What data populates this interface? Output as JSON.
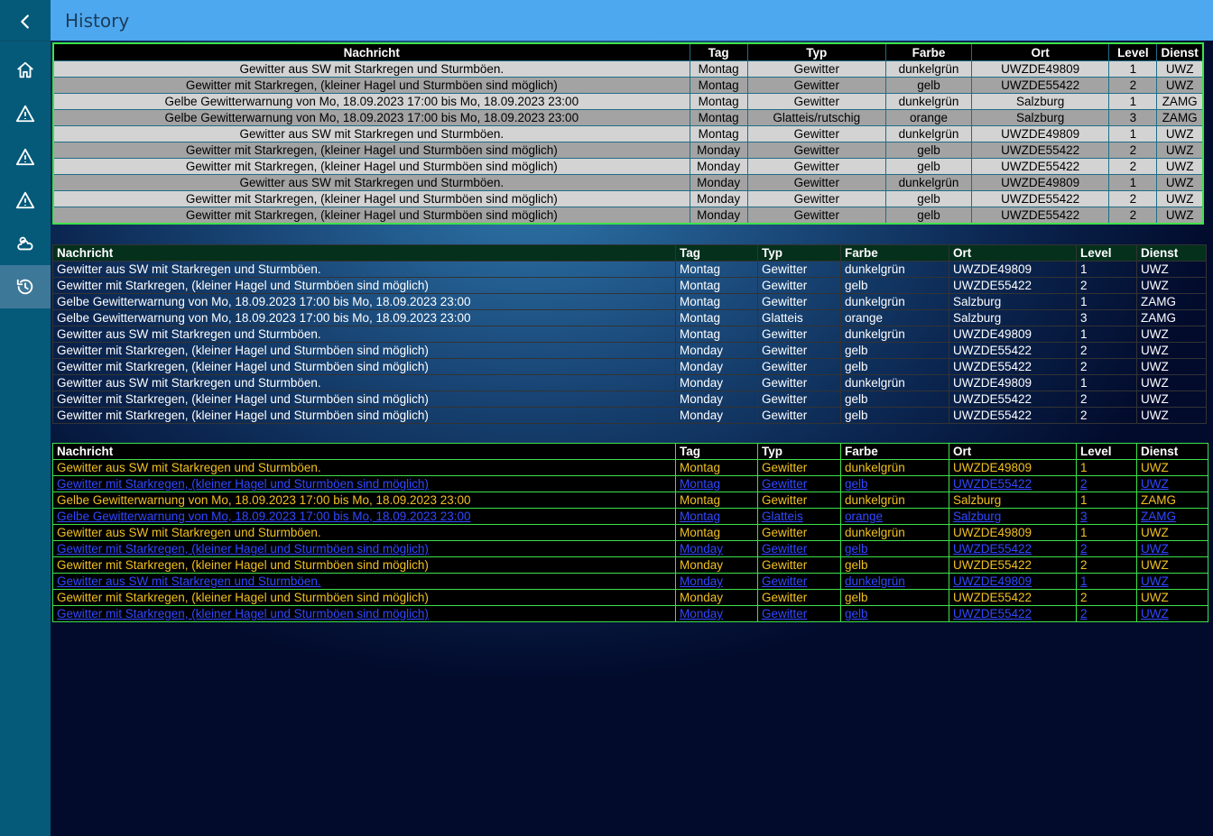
{
  "header": {
    "title": "History"
  },
  "sidebar": {
    "items": [
      {
        "id": "back",
        "icon": "back-chevron-icon"
      },
      {
        "id": "home",
        "icon": "home-icon"
      },
      {
        "id": "warn1",
        "icon": "warning-icon"
      },
      {
        "id": "warn2",
        "icon": "warning-icon"
      },
      {
        "id": "warn3",
        "icon": "warning-icon"
      },
      {
        "id": "weather",
        "icon": "weather-icon"
      },
      {
        "id": "history",
        "icon": "history-icon",
        "active": true
      }
    ]
  },
  "columns": [
    "Nachricht",
    "Tag",
    "Typ",
    "Farbe",
    "Ort",
    "Level",
    "Dienst"
  ],
  "table1_rows": [
    [
      "Gewitter aus SW mit Starkregen und Sturmböen.",
      "Montag",
      "Gewitter",
      "dunkelgrün",
      "UWZDE49809",
      "1",
      "UWZ"
    ],
    [
      "Gewitter mit Starkregen, (kleiner Hagel und Sturmböen sind möglich)",
      "Montag",
      "Gewitter",
      "gelb",
      "UWZDE55422",
      "2",
      "UWZ"
    ],
    [
      "Gelbe Gewitterwarnung von Mo, 18.09.2023 17:00 bis Mo, 18.09.2023 23:00",
      "Montag",
      "Gewitter",
      "dunkelgrün",
      "Salzburg",
      "1",
      "ZAMG"
    ],
    [
      "Gelbe Gewitterwarnung von Mo, 18.09.2023 17:00 bis Mo, 18.09.2023 23:00",
      "Montag",
      "Glatteis/rutschig",
      "orange",
      "Salzburg",
      "3",
      "ZAMG"
    ],
    [
      "Gewitter aus SW mit Starkregen und Sturmböen.",
      "Montag",
      "Gewitter",
      "dunkelgrün",
      "UWZDE49809",
      "1",
      "UWZ"
    ],
    [
      "Gewitter mit Starkregen, (kleiner Hagel und Sturmböen sind möglich)",
      "Monday",
      "Gewitter",
      "gelb",
      "UWZDE55422",
      "2",
      "UWZ"
    ],
    [
      "Gewitter mit Starkregen, (kleiner Hagel und Sturmböen sind möglich)",
      "Monday",
      "Gewitter",
      "gelb",
      "UWZDE55422",
      "2",
      "UWZ"
    ],
    [
      "Gewitter aus SW mit Starkregen und Sturmböen.",
      "Monday",
      "Gewitter",
      "dunkelgrün",
      "UWZDE49809",
      "1",
      "UWZ"
    ],
    [
      "Gewitter mit Starkregen, (kleiner Hagel und Sturmböen sind möglich)",
      "Monday",
      "Gewitter",
      "gelb",
      "UWZDE55422",
      "2",
      "UWZ"
    ],
    [
      "Gewitter mit Starkregen, (kleiner Hagel und Sturmböen sind möglich)",
      "Monday",
      "Gewitter",
      "gelb",
      "UWZDE55422",
      "2",
      "UWZ"
    ]
  ],
  "table2_rows": [
    [
      "Gewitter aus SW mit Starkregen und Sturmböen.",
      "Montag",
      "Gewitter",
      "dunkelgrün",
      "UWZDE49809",
      "1",
      "UWZ"
    ],
    [
      "Gewitter mit Starkregen, (kleiner Hagel und Sturmböen sind möglich)",
      "Montag",
      "Gewitter",
      "gelb",
      "UWZDE55422",
      "2",
      "UWZ"
    ],
    [
      "Gelbe Gewitterwarnung von Mo, 18.09.2023 17:00 bis Mo, 18.09.2023 23:00",
      "Montag",
      "Gewitter",
      "dunkelgrün",
      "Salzburg",
      "1",
      "ZAMG"
    ],
    [
      "Gelbe Gewitterwarnung von Mo, 18.09.2023 17:00 bis Mo, 18.09.2023 23:00",
      "Montag",
      "Glatteis",
      "orange",
      "Salzburg",
      "3",
      "ZAMG"
    ],
    [
      "Gewitter aus SW mit Starkregen und Sturmböen.",
      "Montag",
      "Gewitter",
      "dunkelgrün",
      "UWZDE49809",
      "1",
      "UWZ"
    ],
    [
      "Gewitter mit Starkregen, (kleiner Hagel und Sturmböen sind möglich)",
      "Monday",
      "Gewitter",
      "gelb",
      "UWZDE55422",
      "2",
      "UWZ"
    ],
    [
      "Gewitter mit Starkregen, (kleiner Hagel und Sturmböen sind möglich)",
      "Monday",
      "Gewitter",
      "gelb",
      "UWZDE55422",
      "2",
      "UWZ"
    ],
    [
      "Gewitter aus SW mit Starkregen und Sturmböen.",
      "Monday",
      "Gewitter",
      "dunkelgrün",
      "UWZDE49809",
      "1",
      "UWZ"
    ],
    [
      "Gewitter mit Starkregen, (kleiner Hagel und Sturmböen sind möglich)",
      "Monday",
      "Gewitter",
      "gelb",
      "UWZDE55422",
      "2",
      "UWZ"
    ],
    [
      "Gewitter mit Starkregen, (kleiner Hagel und Sturmböen sind möglich)",
      "Monday",
      "Gewitter",
      "gelb",
      "UWZDE55422",
      "2",
      "UWZ"
    ]
  ],
  "table3_rows": [
    [
      "Gewitter aus SW mit Starkregen und Sturmböen.",
      "Montag",
      "Gewitter",
      "dunkelgrün",
      "UWZDE49809",
      "1",
      "UWZ"
    ],
    [
      "Gewitter mit Starkregen, (kleiner Hagel und Sturmböen sind möglich)",
      "Montag",
      "Gewitter",
      "gelb",
      "UWZDE55422",
      "2",
      "UWZ"
    ],
    [
      "Gelbe Gewitterwarnung von Mo, 18.09.2023 17:00 bis Mo, 18.09.2023 23:00",
      "Montag",
      "Gewitter",
      "dunkelgrün",
      "Salzburg",
      "1",
      "ZAMG"
    ],
    [
      "Gelbe Gewitterwarnung von Mo, 18.09.2023 17:00 bis Mo, 18.09.2023 23:00",
      "Montag",
      "Glatteis",
      "orange",
      "Salzburg",
      "3",
      "ZAMG"
    ],
    [
      "Gewitter aus SW mit Starkregen und Sturmböen.",
      "Montag",
      "Gewitter",
      "dunkelgrün",
      "UWZDE49809",
      "1",
      "UWZ"
    ],
    [
      "Gewitter mit Starkregen, (kleiner Hagel und Sturmböen sind möglich)",
      "Monday",
      "Gewitter",
      "gelb",
      "UWZDE55422",
      "2",
      "UWZ"
    ],
    [
      "Gewitter mit Starkregen, (kleiner Hagel und Sturmböen sind möglich)",
      "Monday",
      "Gewitter",
      "gelb",
      "UWZDE55422",
      "2",
      "UWZ"
    ],
    [
      "Gewitter aus SW mit Starkregen und Sturmböen.",
      "Monday",
      "Gewitter",
      "dunkelgrün",
      "UWZDE49809",
      "1",
      "UWZ"
    ],
    [
      "Gewitter mit Starkregen, (kleiner Hagel und Sturmböen sind möglich)",
      "Monday",
      "Gewitter",
      "gelb",
      "UWZDE55422",
      "2",
      "UWZ"
    ],
    [
      "Gewitter mit Starkregen, (kleiner Hagel und Sturmböen sind möglich)",
      "Monday",
      "Gewitter",
      "gelb",
      "UWZDE55422",
      "2",
      "UWZ"
    ]
  ],
  "colors": {
    "header_bg": "#4da8f0",
    "sidebar_bg": "#055a7a",
    "table1_border": "#3ee24a",
    "table3_odd_text": "#f0c020",
    "table3_even_text": "#3048ff"
  }
}
